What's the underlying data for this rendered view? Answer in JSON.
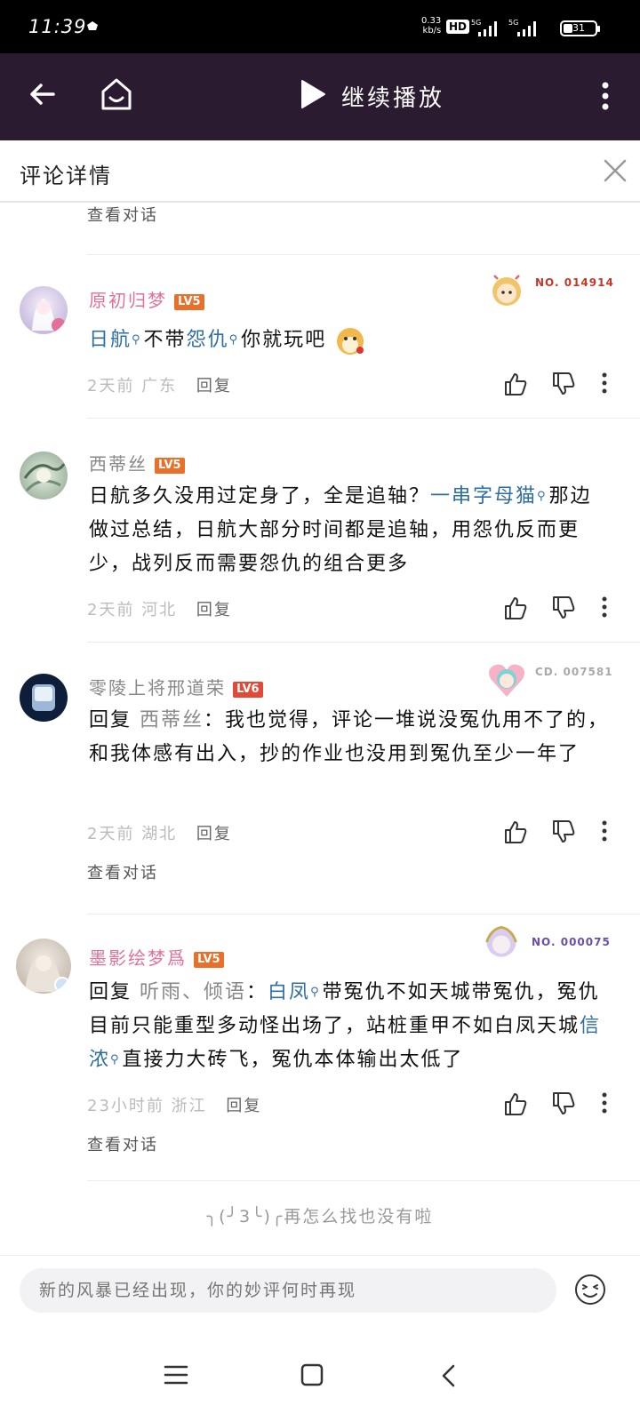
{
  "status_bar": {
    "time": "11:39",
    "net_speed_value": "0.33",
    "net_speed_unit": "kb/s",
    "hd_label": "HD",
    "battery": "31"
  },
  "top_bar": {
    "continue_label": "继续播放"
  },
  "detail_header": {
    "title": "评论详情"
  },
  "top_link": "查看对话",
  "comments": [
    {
      "username": "原初归梦",
      "level": "LV5",
      "badge_no": "NO. 014914",
      "text_parts": [
        "日航",
        "不带",
        "怨仇",
        "你就玩吧"
      ],
      "time": "2天前",
      "region": "广东",
      "reply_label": "回复"
    },
    {
      "username": "西蒂丝",
      "level": "LV5",
      "text_parts": [
        "日航多久没用过定身了，全是追轴？",
        "一串字母猫",
        "那边做过总结，日航大部分时间都是追轴，用怨仇反而更少，战列反而需要怨仇的组合更多"
      ],
      "time": "2天前",
      "region": "河北",
      "reply_label": "回复"
    },
    {
      "username": "零陵上将邢道荣",
      "level": "LV6",
      "badge_no": "CD. 007581",
      "text_parts": [
        "回复",
        "西蒂丝",
        "：我也觉得，评论一堆说没冤仇用不了的，和我体感有出入，抄的作业也没用到冤仇至少一年了"
      ],
      "time": "2天前",
      "region": "湖北",
      "reply_label": "回复",
      "view_dialog": "查看对话"
    },
    {
      "username": "墨影绘梦爲",
      "level": "LV5",
      "badge_no": "NO. 000075",
      "text_parts": [
        "回复",
        "听雨、倾语",
        "：",
        "白凤",
        "带冤仇不如天城带冤仇，冤仇目前只能重型多动怪出场了，站桩重甲不如白凤天城",
        "信浓",
        "直接力大砖飞，冤仇本体输出太低了"
      ],
      "time": "23小时前",
      "region": "浙江",
      "reply_label": "回复",
      "view_dialog": "查看对话"
    }
  ],
  "end_tip": "╮(╯3╰)╭再怎么找也没有啦",
  "input": {
    "placeholder": "新的风暴已经出现，你的妙评何时再现"
  },
  "colors": {
    "topbar_bg": "#2b1b31",
    "pink_name": "#e2709a",
    "link_blue": "#2f6ea3",
    "level_orange": "#e8702a"
  }
}
